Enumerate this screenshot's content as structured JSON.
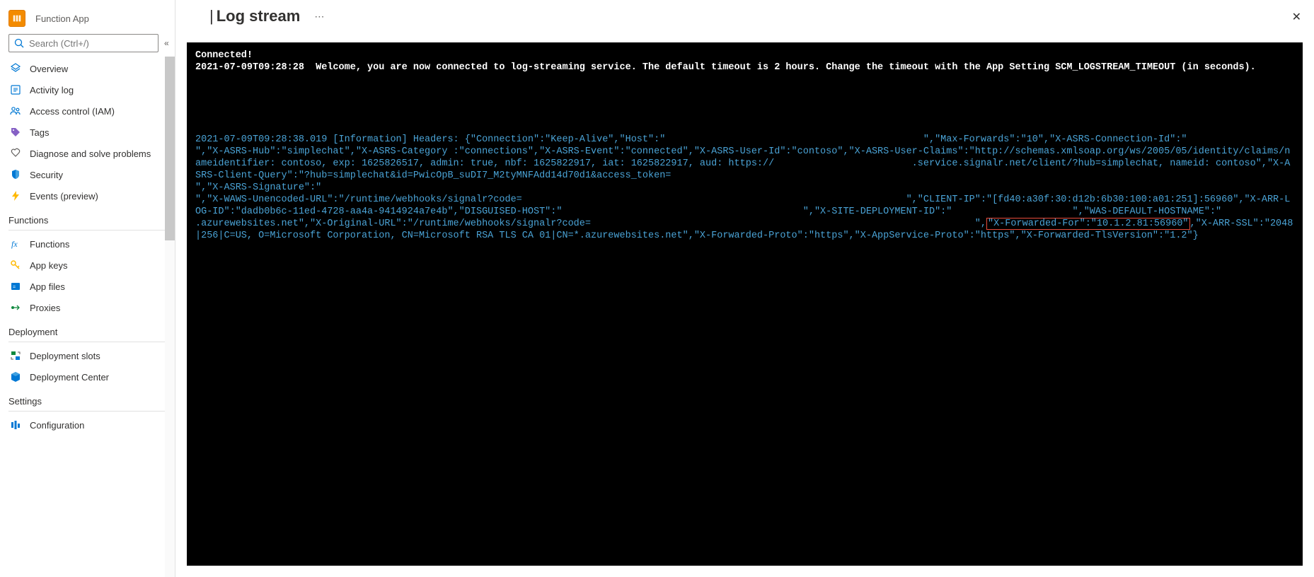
{
  "app": {
    "label": "Function App"
  },
  "search": {
    "placeholder": "Search (Ctrl+/)"
  },
  "nav": {
    "top": [
      {
        "label": "Overview",
        "icon": "overview"
      },
      {
        "label": "Activity log",
        "icon": "activity"
      },
      {
        "label": "Access control (IAM)",
        "icon": "iam"
      },
      {
        "label": "Tags",
        "icon": "tags"
      },
      {
        "label": "Diagnose and solve problems",
        "icon": "diagnose"
      },
      {
        "label": "Security",
        "icon": "security"
      },
      {
        "label": "Events (preview)",
        "icon": "events"
      }
    ],
    "sections": [
      {
        "title": "Functions",
        "items": [
          {
            "label": "Functions",
            "icon": "functions"
          },
          {
            "label": "App keys",
            "icon": "keys"
          },
          {
            "label": "App files",
            "icon": "files"
          },
          {
            "label": "Proxies",
            "icon": "proxies"
          }
        ]
      },
      {
        "title": "Deployment",
        "items": [
          {
            "label": "Deployment slots",
            "icon": "slots"
          },
          {
            "label": "Deployment Center",
            "icon": "center"
          }
        ]
      },
      {
        "title": "Settings",
        "items": [
          {
            "label": "Configuration",
            "icon": "config"
          }
        ]
      }
    ]
  },
  "header": {
    "title": "Log stream"
  },
  "console": {
    "connected": "Connected!",
    "welcome": "2021-07-09T09:28:28  Welcome, you are now connected to log-streaming service. The default timeout is 2 hours. Change the timeout with the App Setting SCM_LOGSTREAM_TIMEOUT (in seconds).",
    "log_pre": "2021-07-09T09:28:38.019 [Information] Headers: {\"Connection\":\"Keep-Alive\",\"Host\":\"                                             \",\"Max-Forwards\":\"10\",\"X-ASRS-Connection-Id\":\"                                            \",\"X-ASRS-Hub\":\"simplechat\",\"X-ASRS-Category :\"connections\",\"X-ASRS-Event\":\"connected\",\"X-ASRS-User-Id\":\"contoso\",\"X-ASRS-User-Claims\":\"http://schemas.xmlsoap.org/ws/2005/05/identity/claims/nameidentifier: contoso, exp: 1625826517, admin: true, nbf: 1625822917, iat: 1625822917, aud: https://                        .service.signalr.net/client/?hub=simplechat, nameid: contoso\",\"X-ASRS-Client-Query\":\"?hub=simplechat&id=PwicOpB_suDI7_M2tyMNFAdd14d70d1&access_token=                                                                                                           \",\"X-ASRS-Signature\":\"                                                                                                                                                                                                                \",\"X-WAWS-Unencoded-URL\":\"/runtime/webhooks/signalr?code=                                                                   \",\"CLIENT-IP\":\"[fd40:a30f:30:d12b:6b30:100:a01:251]:56960\",\"X-ARR-LOG-ID\":\"dadb0b6c-11ed-4728-aa4a-9414924a7e4b\",\"DISGUISED-HOST\":\"                                          \",\"X-SITE-DEPLOYMENT-ID\":\"                     \",\"WAS-DEFAULT-HOSTNAME\":\"                   .azurewebsites.net\",\"X-Original-URL\":\"/runtime/webhooks/signalr?code=                                                                   \",",
    "log_highlight": "\"X-Forwarded-For\":\"10.1.2.81:56960\"",
    "log_post": ",\"X-ARR-SSL\":\"2048|256|C=US, O=Microsoft Corporation, CN=Microsoft RSA TLS CA 01|CN=*.azurewebsites.net\",\"X-Forwarded-Proto\":\"https\",\"X-AppService-Proto\":\"https\",\"X-Forwarded-TlsVersion\":\"1.2\"}"
  }
}
